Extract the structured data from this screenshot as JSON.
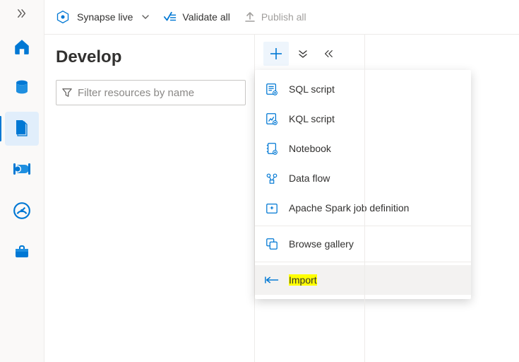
{
  "topbar": {
    "workspace_label": "Synapse live",
    "validate_label": "Validate all",
    "publish_label": "Publish all"
  },
  "page": {
    "title": "Develop",
    "filter_placeholder": "Filter resources by name"
  },
  "menu": {
    "sql": "SQL script",
    "kql": "KQL script",
    "notebook": "Notebook",
    "dataflow": "Data flow",
    "sparkjob": "Apache Spark job definition",
    "gallery": "Browse gallery",
    "import": "Import"
  }
}
